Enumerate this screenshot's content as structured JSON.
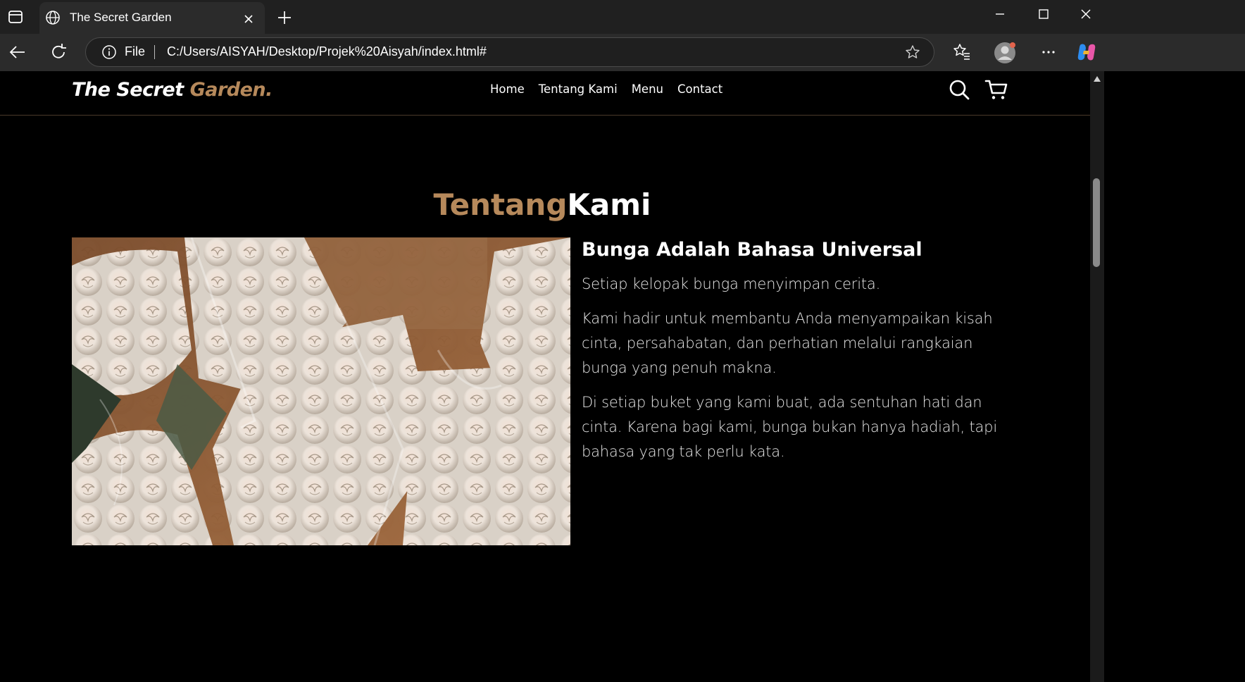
{
  "browser": {
    "tab_title": "The Secret Garden",
    "address_scheme_label": "File",
    "url": "C:/Users/AISYAH/Desktop/Projek%20Aisyah/index.html#",
    "icons": [
      "sidebar-icon",
      "globe-icon",
      "close-icon",
      "plus-icon",
      "minimize-icon",
      "maximize-icon",
      "close-window-icon",
      "back-icon",
      "refresh-icon",
      "info-icon",
      "star-icon",
      "favorites-icon",
      "profile-icon",
      "more-icon",
      "copilot-icon"
    ]
  },
  "site": {
    "logo_main": "The Secret ",
    "logo_accent": "Garden.",
    "nav": [
      "Home",
      "Tentang Kami",
      "Menu",
      "Contact"
    ],
    "icons": [
      "search-icon",
      "cart-icon"
    ],
    "colors": {
      "accent": "#b6895b",
      "background": "#000000",
      "text": "#ffffff"
    }
  },
  "about": {
    "title_accent": "Tentang",
    "title_main": "Kami",
    "heading": "Bunga Adalah Bahasa Universal",
    "paragraphs": [
      "Setiap kelopak bunga menyimpan cerita.",
      "Kami hadir untuk membantu Anda menyampaikan kisah cinta, persahabatan, dan perhatian melalui rangkaian bunga yang penuh makna.",
      "Di setiap buket yang kami buat, ada sentuhan hati dan cinta. Karena bagi kami, bunga bukan hanya hadiah, tapi bahasa yang tak perlu kata."
    ]
  }
}
